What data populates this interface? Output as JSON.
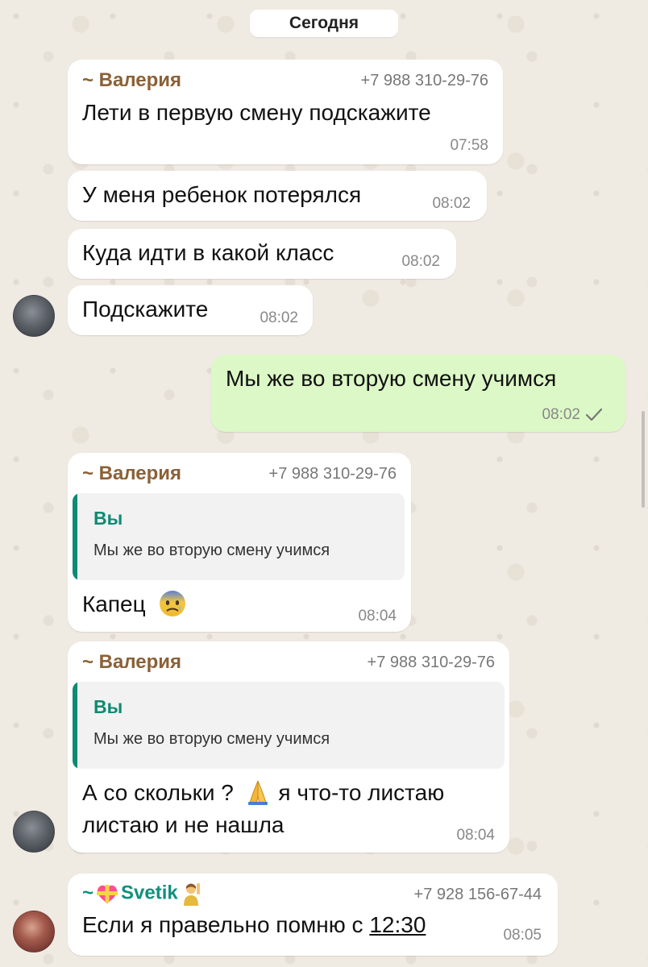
{
  "date_divider": "Сегодня",
  "messages": [
    {
      "sender": "~ Валерия",
      "phone": "+7 988 310-29-76",
      "text": "Лети в первую смену подскажите",
      "time": "07:58"
    },
    {
      "text": "У меня ребенок потерялся",
      "time": "08:02"
    },
    {
      "text": "Куда идти в какой класс",
      "time": "08:02"
    },
    {
      "text": "Подскажите",
      "time": "08:02"
    },
    {
      "text": "Мы же во вторую смену учимся",
      "time": "08:02",
      "outgoing": true,
      "status": "sent"
    },
    {
      "sender": "~ Валерия",
      "phone": "+7 988 310-29-76",
      "quote_name": "Вы",
      "quote_text": "Мы же во вторую смену учимся",
      "text": "Капец",
      "emoji": "anxious-face-icon",
      "time": "08:04"
    },
    {
      "sender": "~ Валерия",
      "phone": "+7 988 310-29-76",
      "quote_name": "Вы",
      "quote_text": "Мы же во вторую смену учимся",
      "text_line1a": "А со скольки ?",
      "text_line1b": "я что-то листаю",
      "text_line2": "листаю и не нашла",
      "emoji": "folded-hands-icon",
      "time": "08:04"
    },
    {
      "sender_prefix": "~",
      "sender": "Svetik",
      "phone": "+7 928 156-67-44",
      "text_a": "Если я правельно помню с",
      "text_link": "12:30",
      "time": "08:05"
    }
  ],
  "colors": {
    "incoming": "#ffffff",
    "outgoing": "#dcf8c6",
    "sender": "#8a6138",
    "quote_accent": "#0f8a73",
    "background": "#efeae2"
  }
}
